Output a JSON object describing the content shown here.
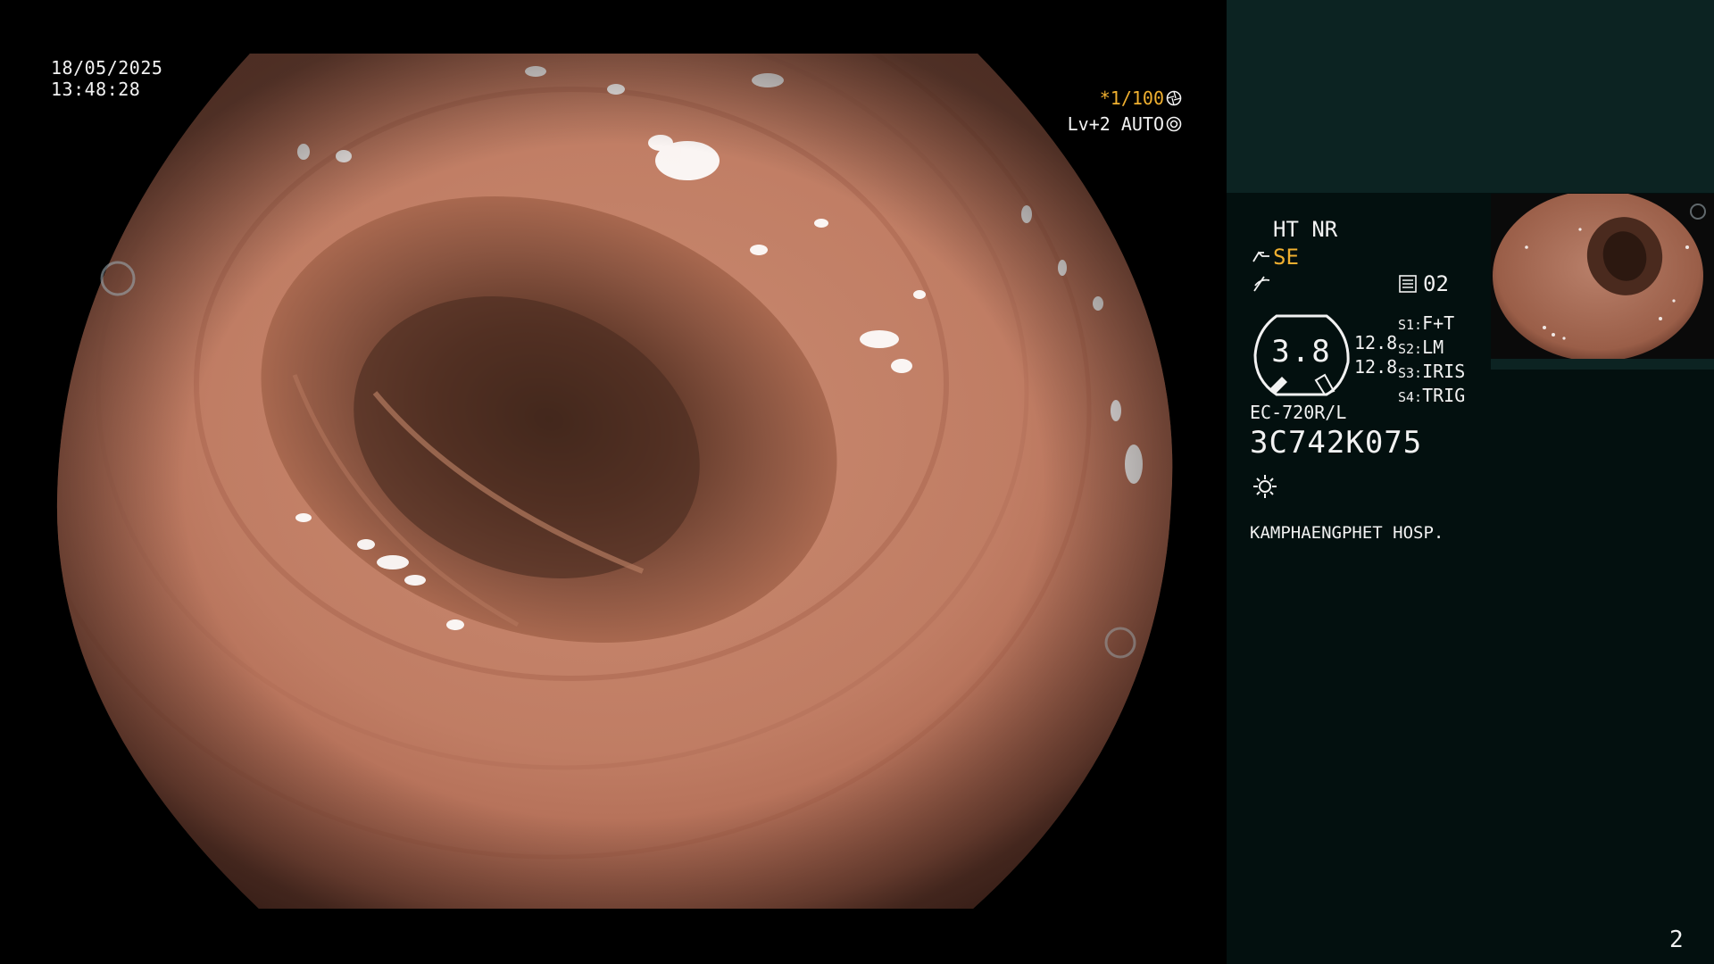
{
  "main": {
    "date": "18/05/2025",
    "time": "13:48:28",
    "shutter": "*1/100",
    "iris": "Lv+2 AUTO"
  },
  "panel": {
    "enhancement": "HT NR",
    "mode": "SE",
    "memory": "02",
    "dial_value": "3.8",
    "values": [
      "12.8",
      "12.8"
    ],
    "switches": [
      {
        "key": "S1:",
        "value": "F+T"
      },
      {
        "key": "S2:",
        "value": "LM"
      },
      {
        "key": "S3:",
        "value": "IRIS"
      },
      {
        "key": "S4:",
        "value": "TRIG"
      }
    ],
    "scope_model": "EC-720R/L",
    "scope_serial": "3C742K075",
    "hospital": "KAMPHAENGPHET HOSP.",
    "page": "2"
  },
  "colors": {
    "accent": "#f0b030",
    "panel_bg": "#03100f",
    "panel_top": "#0c2322"
  },
  "icons": [
    "aperture-icon",
    "gear-icon",
    "scope-icon",
    "structure-icon",
    "memory-icon",
    "dial-icon",
    "light-icon"
  ]
}
